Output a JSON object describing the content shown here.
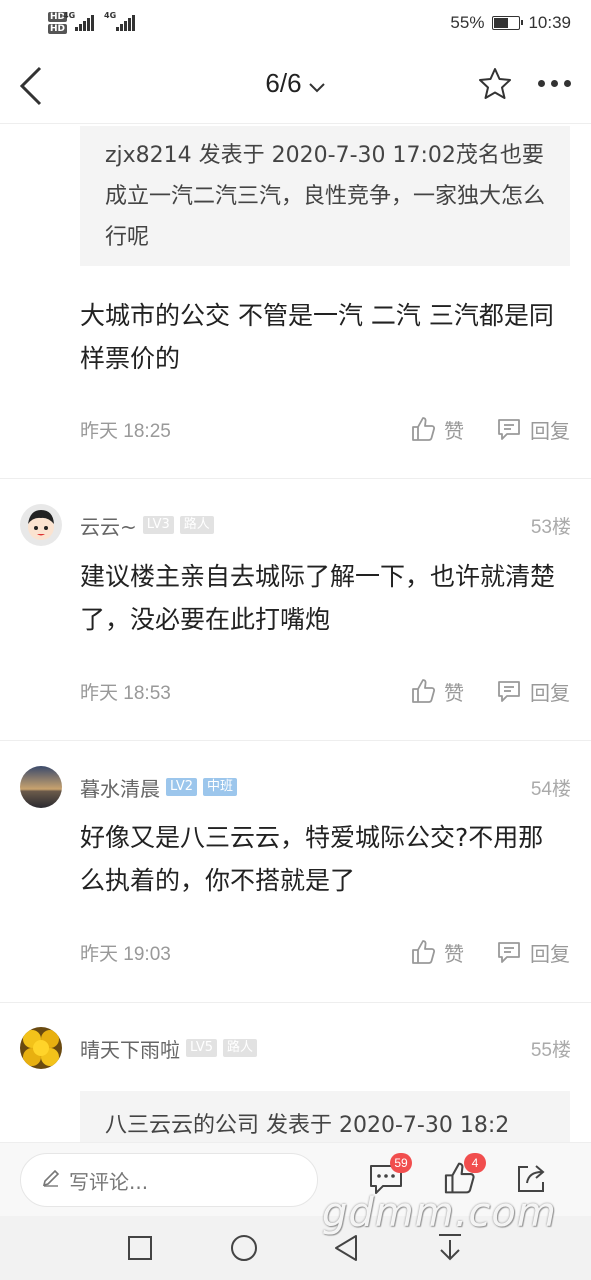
{
  "status_bar": {
    "hd1": "HD",
    "hd2": "HD",
    "net1": "4G",
    "net2": "4G",
    "battery_percent_label": "55%",
    "battery_level": 0.55,
    "time": "10:39"
  },
  "nav": {
    "page_indicator": "6/6"
  },
  "posts": [
    {
      "quote": "zjx8214 发表于 2020-7-30 17:02茂名也要成立一汽二汽三汽，良性竞争，一家独大怎么行呢",
      "text": "大城市的公交 不管是一汽 二汽 三汽都是同样票价的",
      "time": "昨天 18:25",
      "like_label": "赞",
      "reply_label": "回复"
    },
    {
      "user": "云云~",
      "level": "LV3",
      "title": "路人",
      "floor": "53楼",
      "text": "建议楼主亲自去城际了解一下，也许就清楚了，没必要在此打嘴炮",
      "time": "昨天 18:53",
      "like_label": "赞",
      "reply_label": "回复"
    },
    {
      "user": "暮水清晨",
      "level": "LV2",
      "title": "中班",
      "floor": "54楼",
      "text": "好像又是八三云云，特爱城际公交?不用那么执着的，你不搭就是了",
      "time": "昨天 19:03",
      "like_label": "赞",
      "reply_label": "回复"
    },
    {
      "user": "晴天下雨啦",
      "level": "LV5",
      "title": "路人",
      "floor": "55楼",
      "quote": "八三云云的公司 发表于 2020-7-30 18:2"
    }
  ],
  "bottom_bar": {
    "comment_placeholder": "写评论...",
    "comment_count": "59",
    "like_count": "4"
  },
  "watermark": "gdmm.com"
}
